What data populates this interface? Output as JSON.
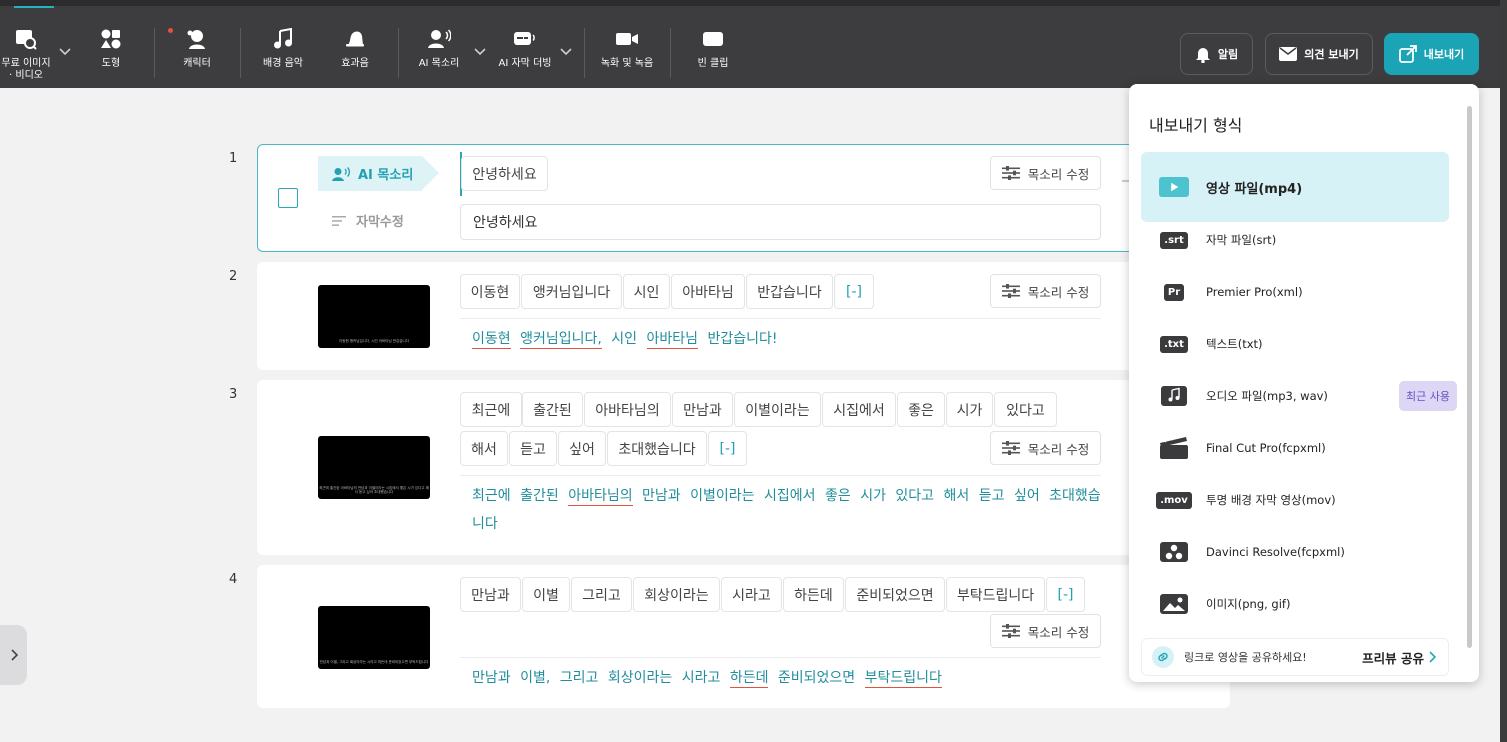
{
  "toolbar": {
    "free_media_label_1": "무료 이미지",
    "free_media_label_2": "· 비디오",
    "shapes_label": "도형",
    "character_label": "캐릭터",
    "bgm_label": "배경 음악",
    "sfx_label": "효과음",
    "ai_voice_label": "AI 목소리",
    "ai_dubbing_label": "AI 자막 더빙",
    "record_label": "녹화 및 녹음",
    "blank_clip_label": "빈 클립",
    "notify_label": "알림",
    "feedback_label": "의견 보내기",
    "export_label": "내보내기"
  },
  "rows": [
    {
      "number": "1",
      "ai_tag": "AI 목소리",
      "subtitle_tag": "자막수정",
      "voice_text": "안녕하세요",
      "subtitle_text": "안녕하세요",
      "voice_edit": "목소리 수정"
    },
    {
      "number": "2",
      "chips": [
        "이동현",
        "앵커님입니다",
        "시인",
        "아바타님",
        "반갑습니다",
        "[-]"
      ],
      "voice_edit": "목소리 수정",
      "subtitle_words": [
        "이동현",
        "앵커님입니다,",
        "시인",
        "아바타님",
        "반갑습니다!"
      ],
      "thumb_caption": "이동현 앵커님입니다, 시인 아바타님 반갑습니다"
    },
    {
      "number": "3",
      "chips_line1": [
        "최근에",
        "출간된",
        "아바타님의",
        "만남과",
        "이별이라는",
        "시집에서",
        "좋은",
        "시가",
        "있다고"
      ],
      "chips_line2": [
        "해서",
        "듣고",
        "싶어",
        "초대했습니다",
        "[-]"
      ],
      "voice_edit": "목소리 수정",
      "subtitle_line1": [
        "최근에",
        "출간된",
        "아바타님의",
        "만남과",
        "이별이라는",
        "시집에서",
        "좋은",
        "시가",
        "있다고",
        "해서",
        "듣고",
        "싶어",
        "초대했습"
      ],
      "subtitle_line2": "니다",
      "thumb_caption": "최근에 출간된 아바타님의 만남과 이별이라는 시집에서 좋은 시가 있다고 해서 듣고 싶어 초대했습니다"
    },
    {
      "number": "4",
      "chips": [
        "만남과",
        "이별",
        "그리고",
        "회상이라는",
        "시라고",
        "하든데",
        "준비되었으면",
        "부탁드립니다",
        "[-]"
      ],
      "voice_edit": "목소리 수정",
      "subtitle_words": [
        "만남과",
        "이별,",
        "그리고",
        "회상이라는",
        "시라고",
        "하든데",
        "준비되었으면",
        "부탁드립니다"
      ],
      "thumb_caption": "만남과 이별, 그리고 회상이라는 시라고 하든데 준비되었으면 부탁드립니다"
    }
  ],
  "export_menu": {
    "title": "내보내기 형식",
    "items": [
      {
        "label": "영상 파일(mp4)",
        "icon": "play-icon"
      },
      {
        "label": "자막 파일(srt)",
        "badge": ".srt"
      },
      {
        "label": "Premier Pro(xml)",
        "badge": "Pr"
      },
      {
        "label": "텍스트(txt)",
        "badge": ".txt"
      },
      {
        "label": "오디오 파일(mp3, wav)",
        "icon": "music-note-icon",
        "tag": "최근 사용"
      },
      {
        "label": "Final Cut Pro(fcpxml)",
        "icon": "clapperboard-icon"
      },
      {
        "label": "투명 배경 자막 영상(mov)",
        "badge": ".mov"
      },
      {
        "label": "Davinci Resolve(fcpxml)",
        "icon": "davinci-icon"
      },
      {
        "label": "이미지(png, gif)",
        "icon": "image-icon"
      }
    ],
    "share_text": "링크로 영상을 공유하세요!",
    "share_cta": "프리뷰 공유"
  },
  "colors": {
    "accent": "#1ba4b6",
    "topbar": "#3d3d3f",
    "selected_bg": "#d6f2f6",
    "underline_red": "#e0533e"
  }
}
